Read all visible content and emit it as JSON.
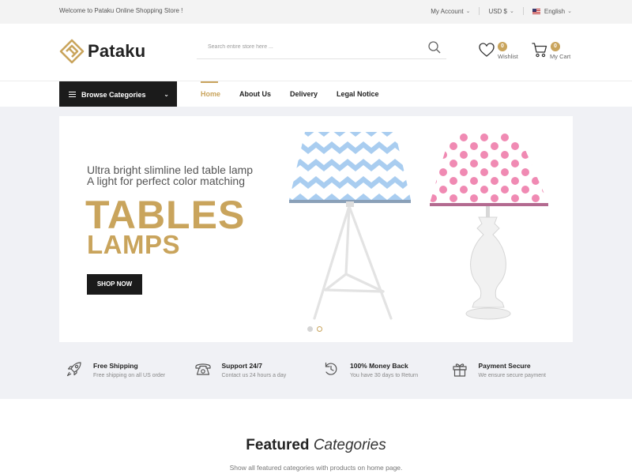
{
  "topbar": {
    "welcome": "Welcome to Pataku Online Shopping Store !",
    "account": "My Account",
    "currency": "USD $",
    "language": "English"
  },
  "header": {
    "logo_text": "Pataku",
    "search_placeholder": "Search entire store here ...",
    "wishlist_count": "0",
    "wishlist_label": "Wishlist",
    "cart_count": "0",
    "cart_label": "My Cart"
  },
  "nav": {
    "browse_label": "Browse Categories",
    "items": [
      {
        "label": "Home",
        "active": true
      },
      {
        "label": "About Us"
      },
      {
        "label": "Delivery"
      },
      {
        "label": "Legal Notice"
      }
    ]
  },
  "slider": {
    "subtitle_1": "Ultra bright slimline led table lamp",
    "subtitle_2": "A light for perfect color matching",
    "title_1": "TABLES",
    "title_2": "LAMPS",
    "cta": "SHOP NOW",
    "slide_count": 2,
    "active_slide": 2
  },
  "features": [
    {
      "icon": "rocket-icon",
      "title": "Free Shipping",
      "subtitle": "Free shipping on all US order"
    },
    {
      "icon": "phone-icon",
      "title": "Support 24/7",
      "subtitle": "Contact us 24 hours a day"
    },
    {
      "icon": "refresh-icon",
      "title": "100% Money Back",
      "subtitle": "You have 30 days to Return"
    },
    {
      "icon": "gift-icon",
      "title": "Payment Secure",
      "subtitle": "We ensure secure payment"
    }
  ],
  "featured": {
    "title_bold": "Featured",
    "title_italic": "Categories",
    "subtitle": "Show all featured categories with products on home page."
  },
  "colors": {
    "accent": "#c9a45c",
    "dark": "#1b1b1b",
    "hero_bg": "#f0f1f5"
  }
}
